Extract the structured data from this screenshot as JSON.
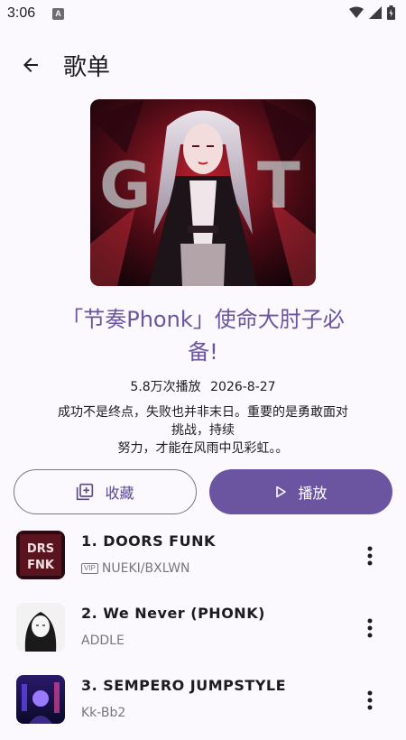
{
  "status": {
    "time": "3:06",
    "notification_icon": "A"
  },
  "header": {
    "title": "歌单",
    "back_icon": "arrow-left-icon"
  },
  "playlist": {
    "title_line1": "「节奏Phonk」使命大肘子必",
    "title_line2": "备!",
    "play_count": "5.8万次播放",
    "date": "2026-8-27",
    "description": [
      "成功不是终点，失败也并非末日。重要的是勇敢面对",
      "挑战，持续",
      "努力，才能在风雨中见彩虹。。"
    ]
  },
  "actions": {
    "favorite_label": "收藏",
    "play_label": "播放"
  },
  "tracks": [
    {
      "title": "1. DOORS FUNK",
      "artist": "NUEKI/BXLWN",
      "vip": "VIP"
    },
    {
      "title": "2. We Never (PHONK)",
      "artist": "ADDLE"
    },
    {
      "title": "3. SEMPERO JUMPSTYLE",
      "artist": "Kk-Bb2"
    }
  ],
  "colors": {
    "background": "#fbf8fe",
    "accent": "#6b55a0",
    "text": "#1c1b20",
    "secondary_text": "#7a757f"
  }
}
